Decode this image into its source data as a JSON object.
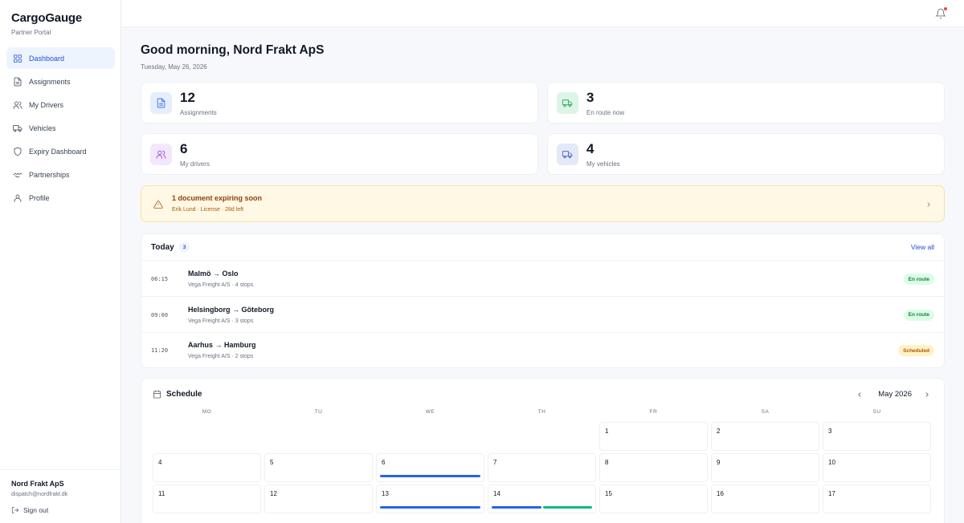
{
  "brand": {
    "name": "CargoGauge",
    "subtitle": "Partner Portal"
  },
  "nav": [
    {
      "label": "Dashboard",
      "icon": "grid-icon",
      "active": true
    },
    {
      "label": "Assignments",
      "icon": "document-icon"
    },
    {
      "label": "My Drivers",
      "icon": "users-icon"
    },
    {
      "label": "Vehicles",
      "icon": "truck-icon"
    },
    {
      "label": "Expiry Dashboard",
      "icon": "shield-icon"
    },
    {
      "label": "Partnerships",
      "icon": "handshake-icon"
    },
    {
      "label": "Profile",
      "icon": "user-icon"
    }
  ],
  "user": {
    "name": "Nord Frakt ApS",
    "email": "dispatch@nordfrakt.dk",
    "signout": "Sign out"
  },
  "header": {
    "greeting": "Good morning, Nord Frakt ApS",
    "date": "Tuesday, May 26, 2026"
  },
  "stats": [
    {
      "value": "12",
      "label": "Assignments",
      "icon": "document-icon",
      "bg": "#e5eefc",
      "fg": "#2563eb"
    },
    {
      "value": "3",
      "label": "En route now",
      "icon": "truck-icon",
      "bg": "#dcf5e6",
      "fg": "#16a34a"
    },
    {
      "value": "6",
      "label": "My drivers",
      "icon": "users-icon",
      "bg": "#f3e8fb",
      "fg": "#9333ea"
    },
    {
      "value": "4",
      "label": "My vehicles",
      "icon": "truck-icon",
      "bg": "#e4e9f7",
      "fg": "#3b5bcc"
    }
  ],
  "alert": {
    "title": "1 document expiring soon",
    "detail": "Erik Lund · License · 28d left"
  },
  "today": {
    "title": "Today",
    "count": "3",
    "view_all": "View all",
    "rows": [
      {
        "time": "06:15",
        "route": "Malmö → Oslo",
        "meta": "Vega Freight A/S · 4 stops",
        "status": "En route",
        "tone": "green"
      },
      {
        "time": "09:00",
        "route": "Helsingborg → Göteborg",
        "meta": "Vega Freight A/S · 3 stops",
        "status": "En route",
        "tone": "green"
      },
      {
        "time": "11:20",
        "route": "Aarhus → Hamburg",
        "meta": "Vega Freight A/S · 2 stops",
        "status": "Scheduled",
        "tone": "amber"
      }
    ]
  },
  "schedule": {
    "title": "Schedule",
    "month": "May 2026",
    "weekdays": [
      "MO",
      "TU",
      "WE",
      "TH",
      "FR",
      "SA",
      "SU"
    ],
    "colors": {
      "blue": "#2563eb",
      "green": "#10b981"
    },
    "days": [
      {
        "day": "1",
        "col": 4,
        "row": 0,
        "bars": []
      },
      {
        "day": "2",
        "col": 5,
        "row": 0,
        "bars": []
      },
      {
        "day": "3",
        "col": 6,
        "row": 0,
        "bars": []
      },
      {
        "day": "4",
        "col": 0,
        "row": 1,
        "bars": []
      },
      {
        "day": "5",
        "col": 1,
        "row": 1,
        "bars": []
      },
      {
        "day": "6",
        "col": 2,
        "row": 1,
        "bars": [
          "blue"
        ]
      },
      {
        "day": "7",
        "col": 3,
        "row": 1,
        "bars": []
      },
      {
        "day": "8",
        "col": 4,
        "row": 1,
        "bars": []
      },
      {
        "day": "9",
        "col": 5,
        "row": 1,
        "bars": []
      },
      {
        "day": "10",
        "col": 6,
        "row": 1,
        "bars": []
      },
      {
        "day": "11",
        "col": 0,
        "row": 2,
        "bars": []
      },
      {
        "day": "12",
        "col": 1,
        "row": 2,
        "bars": []
      },
      {
        "day": "13",
        "col": 2,
        "row": 2,
        "bars": [
          "blue"
        ]
      },
      {
        "day": "14",
        "col": 3,
        "row": 2,
        "bars": [
          "blue",
          "green"
        ]
      },
      {
        "day": "15",
        "col": 4,
        "row": 2,
        "bars": []
      },
      {
        "day": "16",
        "col": 5,
        "row": 2,
        "bars": []
      },
      {
        "day": "17",
        "col": 6,
        "row": 2,
        "bars": []
      }
    ]
  }
}
